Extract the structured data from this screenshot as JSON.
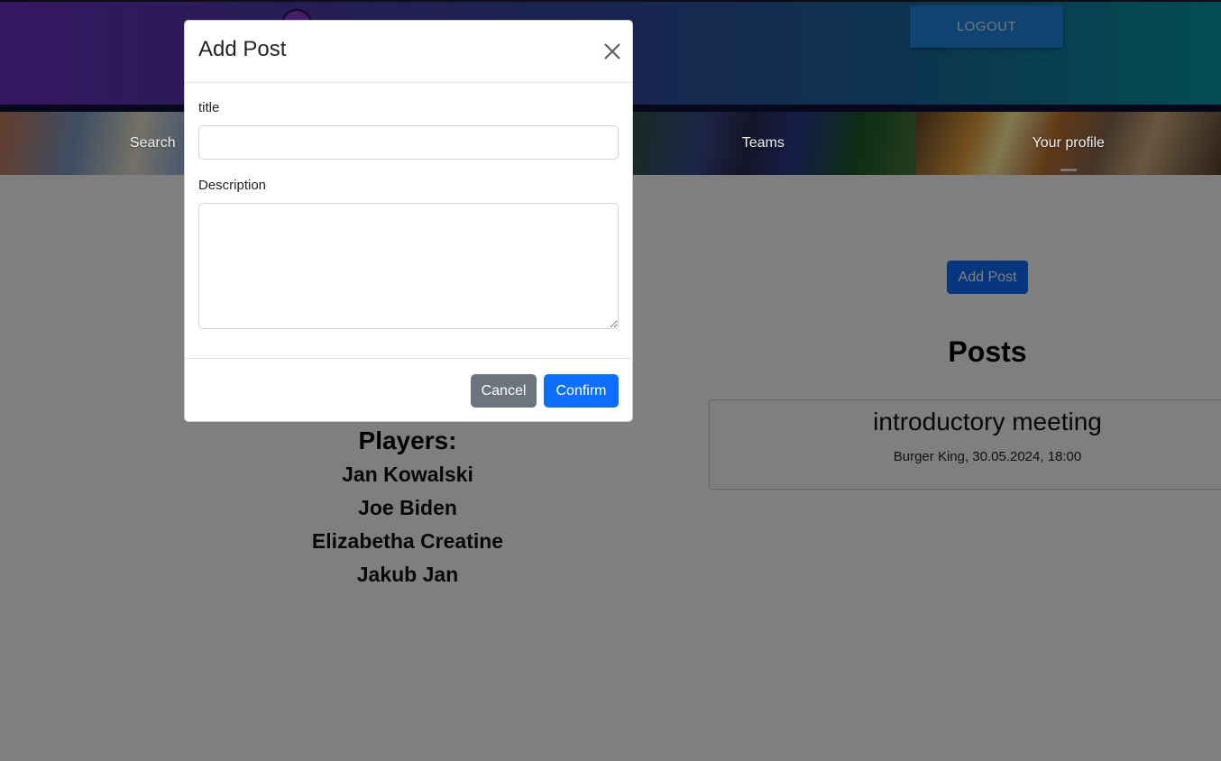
{
  "header": {
    "logout_label": "LOGOUT"
  },
  "nav": {
    "items": [
      {
        "label": "Search"
      },
      {
        "label": ""
      },
      {
        "label": "Teams"
      },
      {
        "label": "Your profile"
      }
    ],
    "active_index": 3
  },
  "main": {
    "add_post_label": "Add Post",
    "posts_heading": "Posts",
    "posts": [
      {
        "title": "introductory meeting",
        "description": "Burger King, 30.05.2024, 18:00"
      }
    ],
    "players_heading": "Players:",
    "players": [
      "Jan Kowalski",
      "Joe Biden",
      "Elizabetha Creatine",
      "Jakub Jan"
    ]
  },
  "modal": {
    "title": "Add Post",
    "title_field_label": "title",
    "title_field_value": "",
    "description_field_label": "Description",
    "description_field_value": "",
    "cancel_label": "Cancel",
    "confirm_label": "Confirm"
  },
  "colors": {
    "primary": "#0d6efd",
    "secondary": "#6c757d",
    "logout": "#1e88e5"
  }
}
